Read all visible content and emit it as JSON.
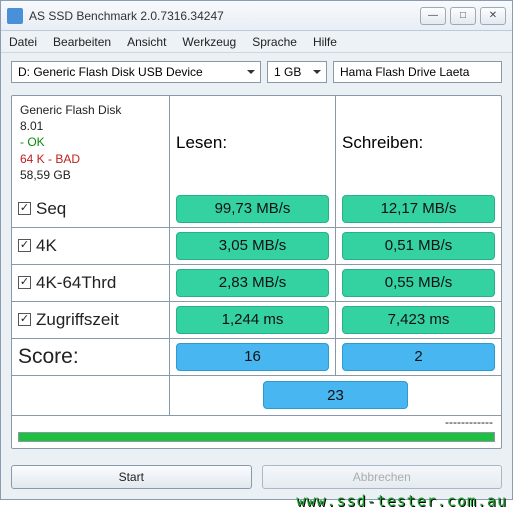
{
  "window": {
    "title": "AS SSD Benchmark 2.0.7316.34247"
  },
  "menu": {
    "file": "Datei",
    "edit": "Bearbeiten",
    "view": "Ansicht",
    "tools": "Werkzeug",
    "language": "Sprache",
    "help": "Hilfe"
  },
  "controls": {
    "device_selected": "D: Generic Flash Disk USB Device",
    "size_selected": "1 GB",
    "drive_name": "Hama Flash Drive Laeta"
  },
  "info": {
    "name": "Generic Flash Disk",
    "firmware": "8.01",
    "ok": " - OK",
    "bad": "64 K - BAD",
    "capacity": "58,59 GB"
  },
  "headers": {
    "read": "Lesen:",
    "write": "Schreiben:"
  },
  "tests": [
    {
      "label": "Seq",
      "checked": true,
      "read": "99,73 MB/s",
      "write": "12,17 MB/s"
    },
    {
      "label": "4K",
      "checked": true,
      "read": "3,05 MB/s",
      "write": "0,51 MB/s"
    },
    {
      "label": "4K-64Thrd",
      "checked": true,
      "read": "2,83 MB/s",
      "write": "0,55 MB/s"
    },
    {
      "label": "Zugriffszeit",
      "checked": true,
      "read": "1,244 ms",
      "write": "7,423 ms"
    }
  ],
  "scores": {
    "label": "Score:",
    "read": "16",
    "write": "2",
    "total": "23"
  },
  "progress": {
    "dash": "------------"
  },
  "buttons": {
    "start": "Start",
    "abort": "Abbrechen"
  },
  "watermark": "www.ssd-tester.com.au"
}
